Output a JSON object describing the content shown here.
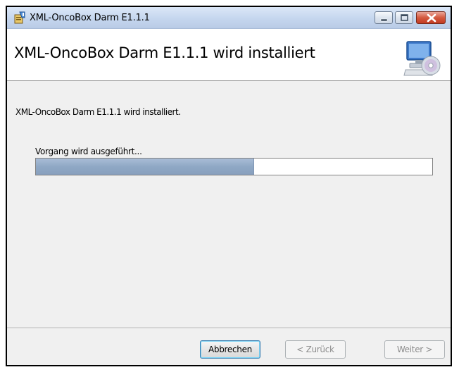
{
  "window": {
    "title": "XML-OncoBox Darm E1.1.1",
    "controls": [
      "minimize-icon",
      "maximize-icon",
      "close-icon"
    ]
  },
  "header": {
    "title": "XML-OncoBox Darm E1.1.1 wird installiert",
    "icon": "computer-cd-icon"
  },
  "body": {
    "message": "XML-OncoBox Darm E1.1.1 wird installiert.",
    "progress_label": "Vorgang wird ausgeführt...",
    "progress_fraction": 0.55
  },
  "buttons": {
    "cancel": "Abbrechen",
    "back": "< Zurück",
    "next": "Weiter >"
  },
  "colors": {
    "progress_fill": "#8fa8c5",
    "close_button": "#c23b22",
    "titlebar": "#c5d6ee"
  }
}
